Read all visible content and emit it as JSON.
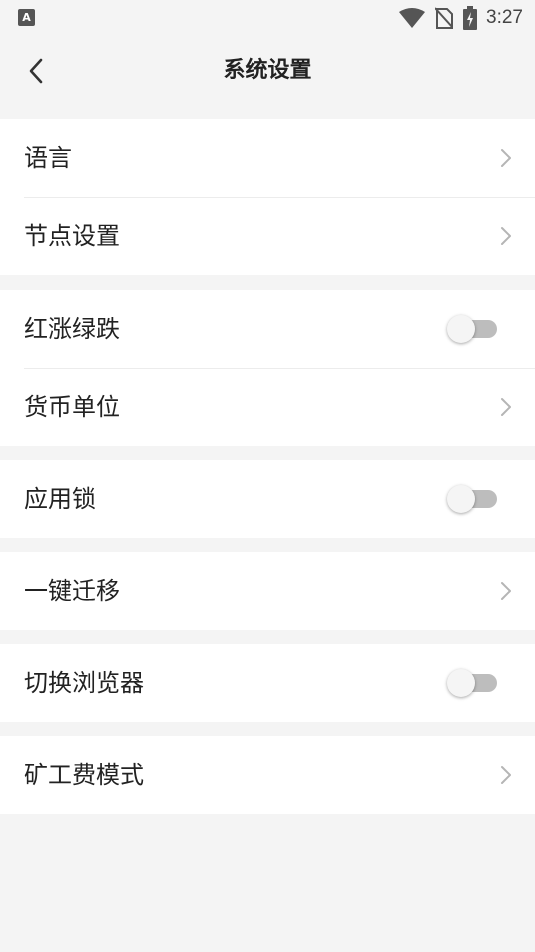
{
  "status_bar": {
    "notification_icon": "A",
    "time": "3:27"
  },
  "header": {
    "title": "系统设置"
  },
  "groups": [
    {
      "items": [
        {
          "label": "语言",
          "control": "chevron"
        },
        {
          "label": "节点设置",
          "control": "chevron"
        }
      ]
    },
    {
      "items": [
        {
          "label": "红涨绿跌",
          "control": "toggle",
          "on": false
        },
        {
          "label": "货币单位",
          "control": "chevron"
        }
      ]
    },
    {
      "items": [
        {
          "label": "应用锁",
          "control": "toggle",
          "on": false
        }
      ]
    },
    {
      "items": [
        {
          "label": "一键迁移",
          "control": "chevron"
        }
      ]
    },
    {
      "items": [
        {
          "label": "切换浏览器",
          "control": "toggle",
          "on": false
        }
      ]
    },
    {
      "items": [
        {
          "label": "矿工费模式",
          "control": "chevron"
        }
      ]
    }
  ]
}
